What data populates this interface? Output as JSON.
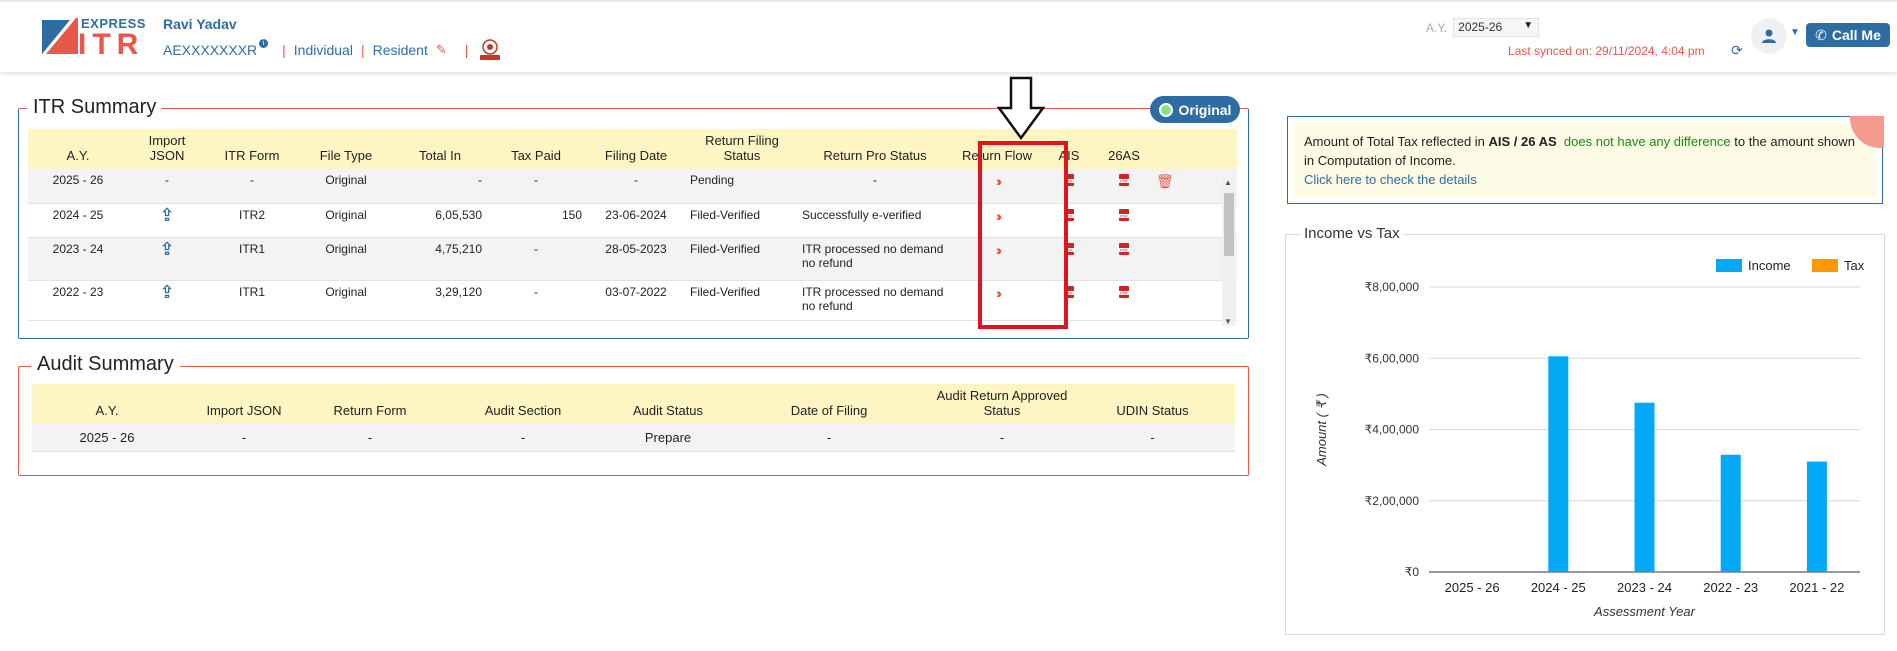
{
  "header": {
    "logo_top": "EXPRESS",
    "logo_main": "ITR",
    "user_name": "Ravi Yadav",
    "pan": "AEXXXXXXXR",
    "status": "Individual",
    "residency": "Resident",
    "ay_label": "A.Y.",
    "ay_value": "2025-26",
    "last_synced": "Last synced on: 29/11/2024, 4:04 pm",
    "call_me": "Call Me",
    "icons": [
      "info-icon",
      "pencil-icon",
      "emblem-icon",
      "sync-icon",
      "user-icon",
      "phone-icon"
    ]
  },
  "itr_summary": {
    "title": "ITR Summary",
    "badge": "Original",
    "columns": [
      "A.Y.",
      "Import JSON",
      "ITR Form",
      "File Type",
      "Total In",
      "Tax Paid",
      "Filing Date",
      "Return Filing Status",
      "Return Pro Status",
      "Return Flow",
      "AIS",
      "26AS"
    ],
    "rows": [
      {
        "ay": "2025 - 26",
        "import": "-",
        "form": "-",
        "type": "Original",
        "total": "-",
        "tax": "-",
        "date": "-",
        "status": "Pending",
        "pro": "-"
      },
      {
        "ay": "2024 - 25",
        "import": "upload",
        "form": "ITR2",
        "type": "Original",
        "total": "6,05,530",
        "tax": "150",
        "date": "23-06-2024",
        "status": "Filed-Verified",
        "pro": "Successfully e-verified"
      },
      {
        "ay": "2023 - 24",
        "import": "upload",
        "form": "ITR1",
        "type": "Original",
        "total": "4,75,210",
        "tax": "-",
        "date": "28-05-2023",
        "status": "Filed-Verified",
        "pro": "ITR processed no demand no refund"
      },
      {
        "ay": "2022 - 23",
        "import": "upload",
        "form": "ITR1",
        "type": "Original",
        "total": "3,29,120",
        "tax": "-",
        "date": "03-07-2022",
        "status": "Filed-Verified",
        "pro": "ITR processed no demand no refund"
      }
    ]
  },
  "audit_summary": {
    "title": "Audit Summary",
    "columns": [
      "A.Y.",
      "Import JSON",
      "Return Form",
      "Audit Section",
      "Audit Status",
      "Date of Filing",
      "Audit Return Approved Status",
      "UDIN Status"
    ],
    "rows": [
      {
        "ay": "2025 - 26",
        "import": "-",
        "form": "-",
        "section": "-",
        "status": "Prepare",
        "date": "-",
        "approved": "-",
        "udin": "-"
      }
    ]
  },
  "ais_notice": {
    "pre": "Amount of Total Tax reflected in ",
    "bold": "AIS / 26 AS",
    "green": "does not have any difference",
    "post": " to the amount shown in Computation of Income.",
    "link": "Click here to check the details"
  },
  "chart_data": {
    "type": "bar",
    "title": "Income vs Tax",
    "xlabel": "Assessment Year",
    "ylabel": "Amount ( ₹ )",
    "categories": [
      "2025 - 26",
      "2024 - 25",
      "2023 - 24",
      "2022 - 23",
      "2021 - 22"
    ],
    "series": [
      {
        "name": "Income",
        "color": "#03a9f4",
        "values": [
          0,
          605530,
          475210,
          329120,
          310000
        ]
      },
      {
        "name": "Tax",
        "color": "#ff9800",
        "values": [
          0,
          150,
          0,
          0,
          0
        ]
      }
    ],
    "ylim": [
      0,
      800000
    ],
    "yticks": [
      0,
      200000,
      400000,
      600000,
      800000
    ],
    "ytick_labels": [
      "₹0",
      "₹2,00,000",
      "₹4,00,000",
      "₹6,00,000",
      "₹8,00,000"
    ],
    "legend": "top-right",
    "grid": true
  }
}
